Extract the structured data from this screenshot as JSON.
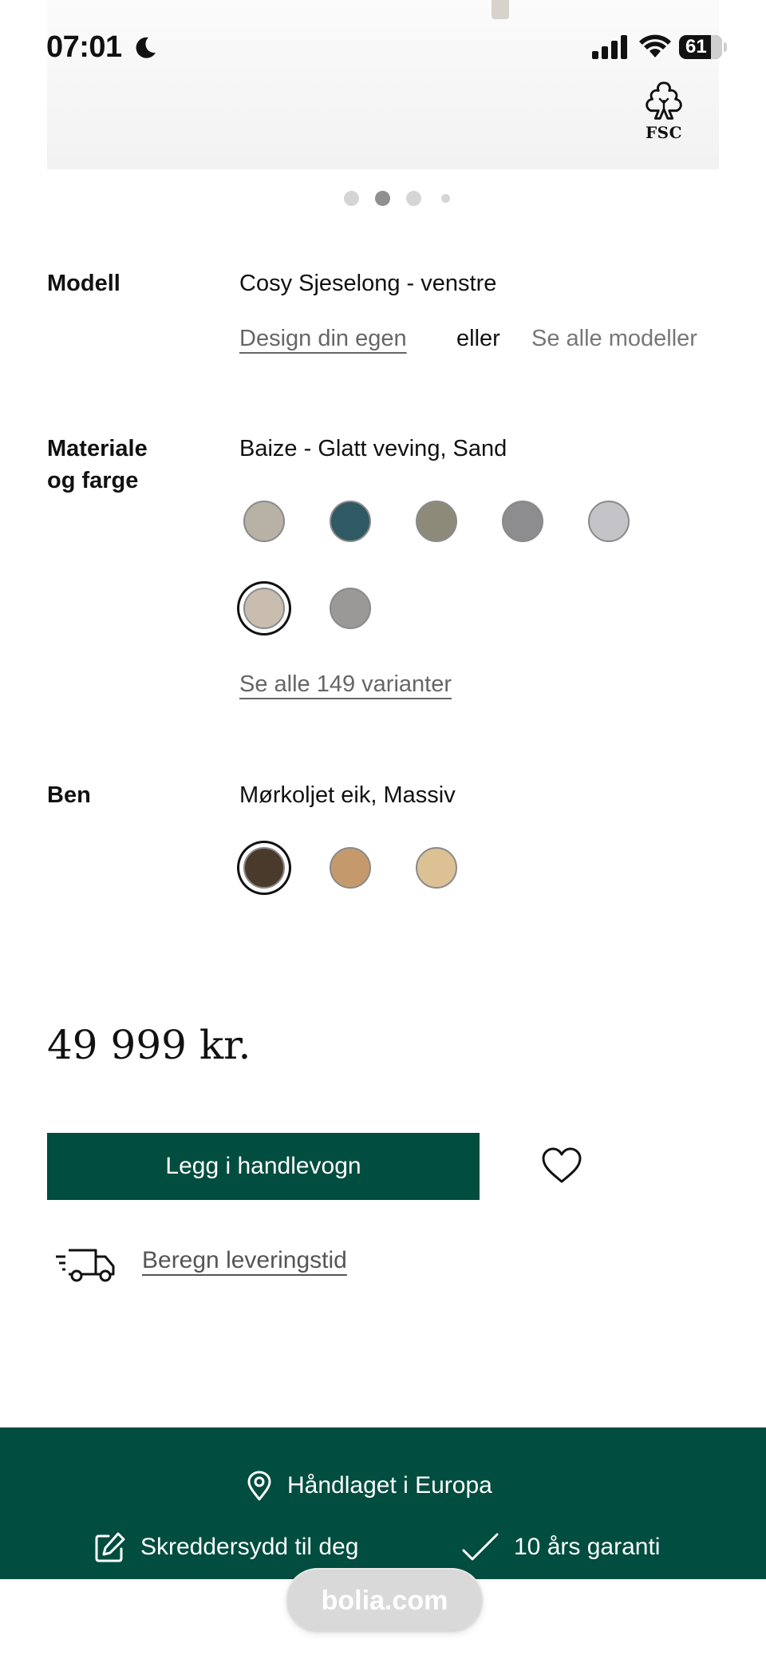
{
  "status_bar": {
    "time": "07:01",
    "battery": "61"
  },
  "hero": {
    "certification_logo_text": "FSC",
    "carousel_dots": 4,
    "carousel_active_index": 1
  },
  "model": {
    "label": "Modell",
    "value": "Cosy Sjeselong - venstre",
    "design_link": "Design din egen",
    "or_text": "eller",
    "all_models_link": "Se alle modeller"
  },
  "material": {
    "label_line1": "Materiale",
    "label_line2": "og farge",
    "value": "Baize - Glatt veving, Sand",
    "swatches": [
      {
        "color": "#b8b2a6",
        "selected": false
      },
      {
        "color": "#2f5a63",
        "selected": false
      },
      {
        "color": "#8e8a79",
        "selected": false
      },
      {
        "color": "#8d8d8f",
        "selected": false
      },
      {
        "color": "#c3c3c8",
        "selected": false
      },
      {
        "color": "#c9bdb0",
        "selected": true
      },
      {
        "color": "#9b9898",
        "selected": false
      }
    ],
    "all_variants_link": "Se alle 149 varianter"
  },
  "legs": {
    "label": "Ben",
    "value": "Mørkoljet eik, Massiv",
    "swatches": [
      {
        "color": "#4a3a2c",
        "selected": true
      },
      {
        "color": "#c49a6c",
        "selected": false
      },
      {
        "color": "#dcc195",
        "selected": false
      }
    ]
  },
  "price": "49 999 kr.",
  "actions": {
    "add_to_cart": "Legg i handlevogn",
    "favorite_icon": "heart-icon",
    "delivery_link": "Beregn leveringstid"
  },
  "footer": {
    "made_in": "Håndlaget i Europa",
    "tailored": "Skreddersydd til deg",
    "warranty": "10 års garanti"
  },
  "browser": {
    "url": "bolia.com"
  },
  "colors": {
    "brand_green": "#014d3f"
  }
}
